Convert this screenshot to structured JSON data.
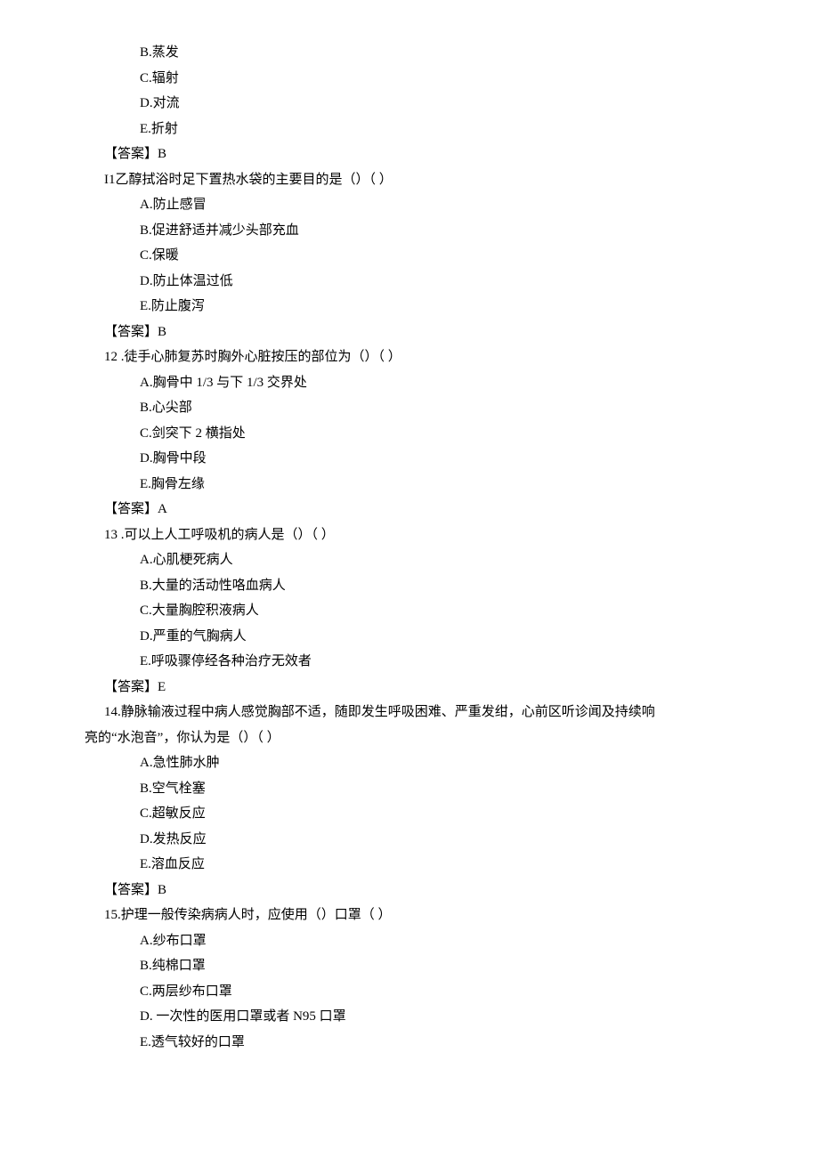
{
  "q10_tail": {
    "optB": "B.蒸发",
    "optC": "C.辐射",
    "optD": "D.对流",
    "optE": "E.折射",
    "answer": "【答案】B"
  },
  "q11": {
    "stem": "I1乙醇拭浴时足下置热水袋的主要目的是（）（            ）",
    "optA": "A.防止感冒",
    "optB": "B.促进舒适并减少头部充血",
    "optC": "C.保暖",
    "optD": "D.防止体温过低",
    "optE": "E.防止腹泻",
    "answer": "【答案】B"
  },
  "q12": {
    "stem": "12  .徒手心肺复苏时胸外心脏按压的部位为（）（        ）",
    "optA": "A.胸骨中 1/3 与下 1/3 交界处",
    "optB": "B.心尖部",
    "optC": "C.剑突下 2 横指处",
    "optD": "D.胸骨中段",
    "optE": "E.胸骨左缘",
    "answer": "【答案】A"
  },
  "q13": {
    "stem": "13  .可以上人工呼吸机的病人是（）（        ）",
    "optA": "A.心肌梗死病人",
    "optB": "B.大量的活动性咯血病人",
    "optC": "C.大量胸腔积液病人",
    "optD": "D.严重的气胸病人",
    "optE": "E.呼吸骤停经各种治疗无效者",
    "answer": "【答案】E"
  },
  "q14": {
    "stem1": "14.静脉输液过程中病人感觉胸部不适，随即发生呼吸困难、严重发绀，心前区听诊闻及持续响",
    "stem2": "亮的“水泡音”，你认为是（）（              ）",
    "optA": "A.急性肺水肿",
    "optB": "B.空气栓塞",
    "optC": "C.超敏反应",
    "optD": "D.发热反应",
    "optE": "E.溶血反应",
    "answer": "【答案】B"
  },
  "q15": {
    "stem": "15.护理一般传染病病人时，应使用（）口罩（            ）",
    "optA": "A.纱布口罩",
    "optB": "B.纯棉口罩",
    "optC": "C.两层纱布口罩",
    "optD": "D.   一次性的医用口罩或者 N95 口罩",
    "optE": "E.透气较好的口罩"
  }
}
